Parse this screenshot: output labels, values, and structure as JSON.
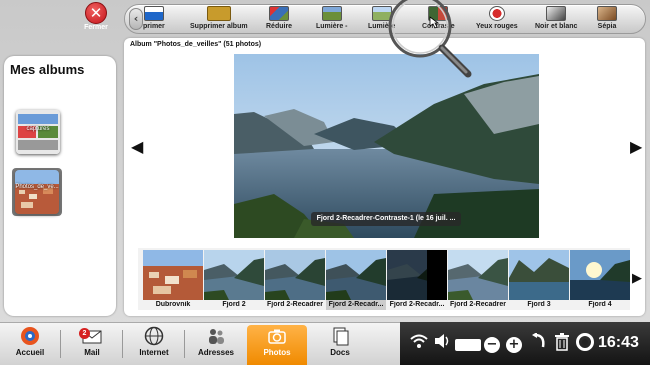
{
  "close_button": {
    "label": "Fermer",
    "icon": "close-icon"
  },
  "toolbar": {
    "back_icon": "chevron-left-icon",
    "tools": [
      {
        "label": "primer",
        "icon": "printer-icon",
        "color": "#1f67c9"
      },
      {
        "label": "Supprimer album",
        "icon": "trash-folder-icon",
        "color": "#c89b2c"
      },
      {
        "label": "Réduire",
        "icon": "reduce-icon",
        "color": "#3a6fb7"
      },
      {
        "label": "Lumière -",
        "icon": "brightness-down-icon",
        "color": "#6b8f3a"
      },
      {
        "label": "Lumière",
        "icon": "brightness-up-icon",
        "color": "#8fb061"
      },
      {
        "label": "Contraste",
        "icon": "contrast-icon",
        "color": "#4a7d3d"
      },
      {
        "label": "Yeux rouges",
        "icon": "red-eye-icon",
        "color": "#d62b2b"
      },
      {
        "label": "Noir et blanc",
        "icon": "black-white-icon",
        "color": "#777777"
      },
      {
        "label": "Sépia",
        "icon": "sepia-icon",
        "color": "#9a6a3a"
      }
    ]
  },
  "sidebar": {
    "title": "Mes albums",
    "albums": [
      {
        "label": "captures",
        "icon": "album-captures-icon"
      },
      {
        "label": "Photos_de_ve...",
        "icon": "album-photos-icon"
      }
    ]
  },
  "main": {
    "album_title": "Album \"Photos_de_veilles\" (51 photos)",
    "photo_caption": "Fjord 2-Recadrer-Contraste-1 (le 16 juil. ...",
    "prev_icon": "arrow-left-icon",
    "next_icon": "arrow-right-icon"
  },
  "filmstrip": {
    "thumbs": [
      {
        "label": "Dubrovnik"
      },
      {
        "label": "Fjord 2"
      },
      {
        "label": "Fjord 2-Recadrer"
      },
      {
        "label": "Fjord 2-Recadr..."
      },
      {
        "label": "Fjord 2-Recadr..."
      },
      {
        "label": "Fjord 2-Recadrer"
      },
      {
        "label": "Fjord 3"
      },
      {
        "label": "Fjord 4"
      }
    ],
    "next_icon": "arrow-right-icon"
  },
  "taskbar": {
    "apps": [
      {
        "label": "Accueil",
        "icon": "home-icon"
      },
      {
        "label": "Mail",
        "icon": "mail-icon",
        "badge": "2"
      },
      {
        "label": "Internet",
        "icon": "globe-icon"
      },
      {
        "label": "Adresses",
        "icon": "contacts-icon"
      },
      {
        "label": "Photos",
        "icon": "camera-icon"
      },
      {
        "label": "Docs",
        "icon": "documents-icon"
      }
    ],
    "clock": "16:43",
    "accent": "#f39a1e"
  }
}
